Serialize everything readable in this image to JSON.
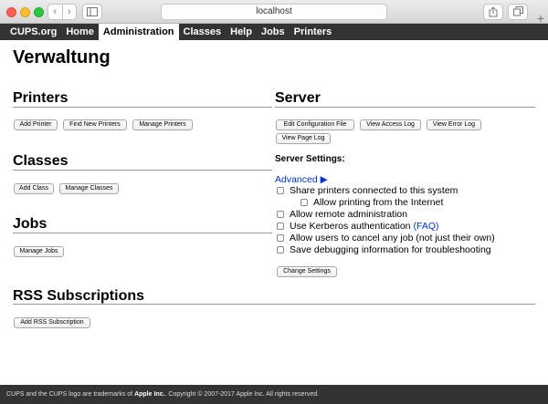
{
  "browser": {
    "url": "localhost",
    "back_glyph": "‹",
    "forward_glyph": "›",
    "new_tab_glyph": "+",
    "icons": [
      "chevron-left-icon",
      "chevron-right-icon",
      "sidebar-icon",
      "share-icon",
      "tabs-icon",
      "plus-icon"
    ]
  },
  "nav": {
    "items": [
      "CUPS.org",
      "Home",
      "Administration",
      "Classes",
      "Help",
      "Jobs",
      "Printers"
    ],
    "active": "Administration"
  },
  "page": {
    "title": "Verwaltung"
  },
  "printers": {
    "heading": "Printers",
    "buttons": [
      "Add Printer",
      "Find New Printers",
      "Manage Printers"
    ]
  },
  "classes": {
    "heading": "Classes",
    "buttons": [
      "Add Class",
      "Manage Classes"
    ]
  },
  "jobs": {
    "heading": "Jobs",
    "buttons": [
      "Manage Jobs"
    ]
  },
  "rss": {
    "heading": "RSS Subscriptions",
    "buttons": [
      "Add RSS Subscription"
    ]
  },
  "server": {
    "heading": "Server",
    "buttons": [
      "Edit Configuration File",
      "View Access Log",
      "View Error Log",
      "View Page Log"
    ],
    "settings_heading": "Server Settings:",
    "advanced_label": "Advanced ▶",
    "options": [
      {
        "label": "Share printers connected to this system",
        "checked": false
      },
      {
        "label": "Allow printing from the Internet",
        "checked": false
      },
      {
        "label": "Allow remote administration",
        "checked": false
      },
      {
        "label": "Use Kerberos authentication",
        "link": "(FAQ)",
        "checked": false
      },
      {
        "label": "Allow users to cancel any job (not just their own)",
        "checked": false
      },
      {
        "label": "Save debugging information for troubleshooting",
        "checked": false
      }
    ],
    "change_button": "Change Settings"
  },
  "footer": {
    "prefix": "CUPS and the CUPS logo are trademarks of",
    "company": "Apple Inc.",
    "copyright": "Copyright © 2007-2017 Apple Inc. All rights reserved."
  },
  "colors": {
    "nav_bg": "#333333",
    "link": "#0033cc",
    "close": "#fc5f57",
    "minimize": "#fdbc2e",
    "maximize": "#29c840"
  }
}
